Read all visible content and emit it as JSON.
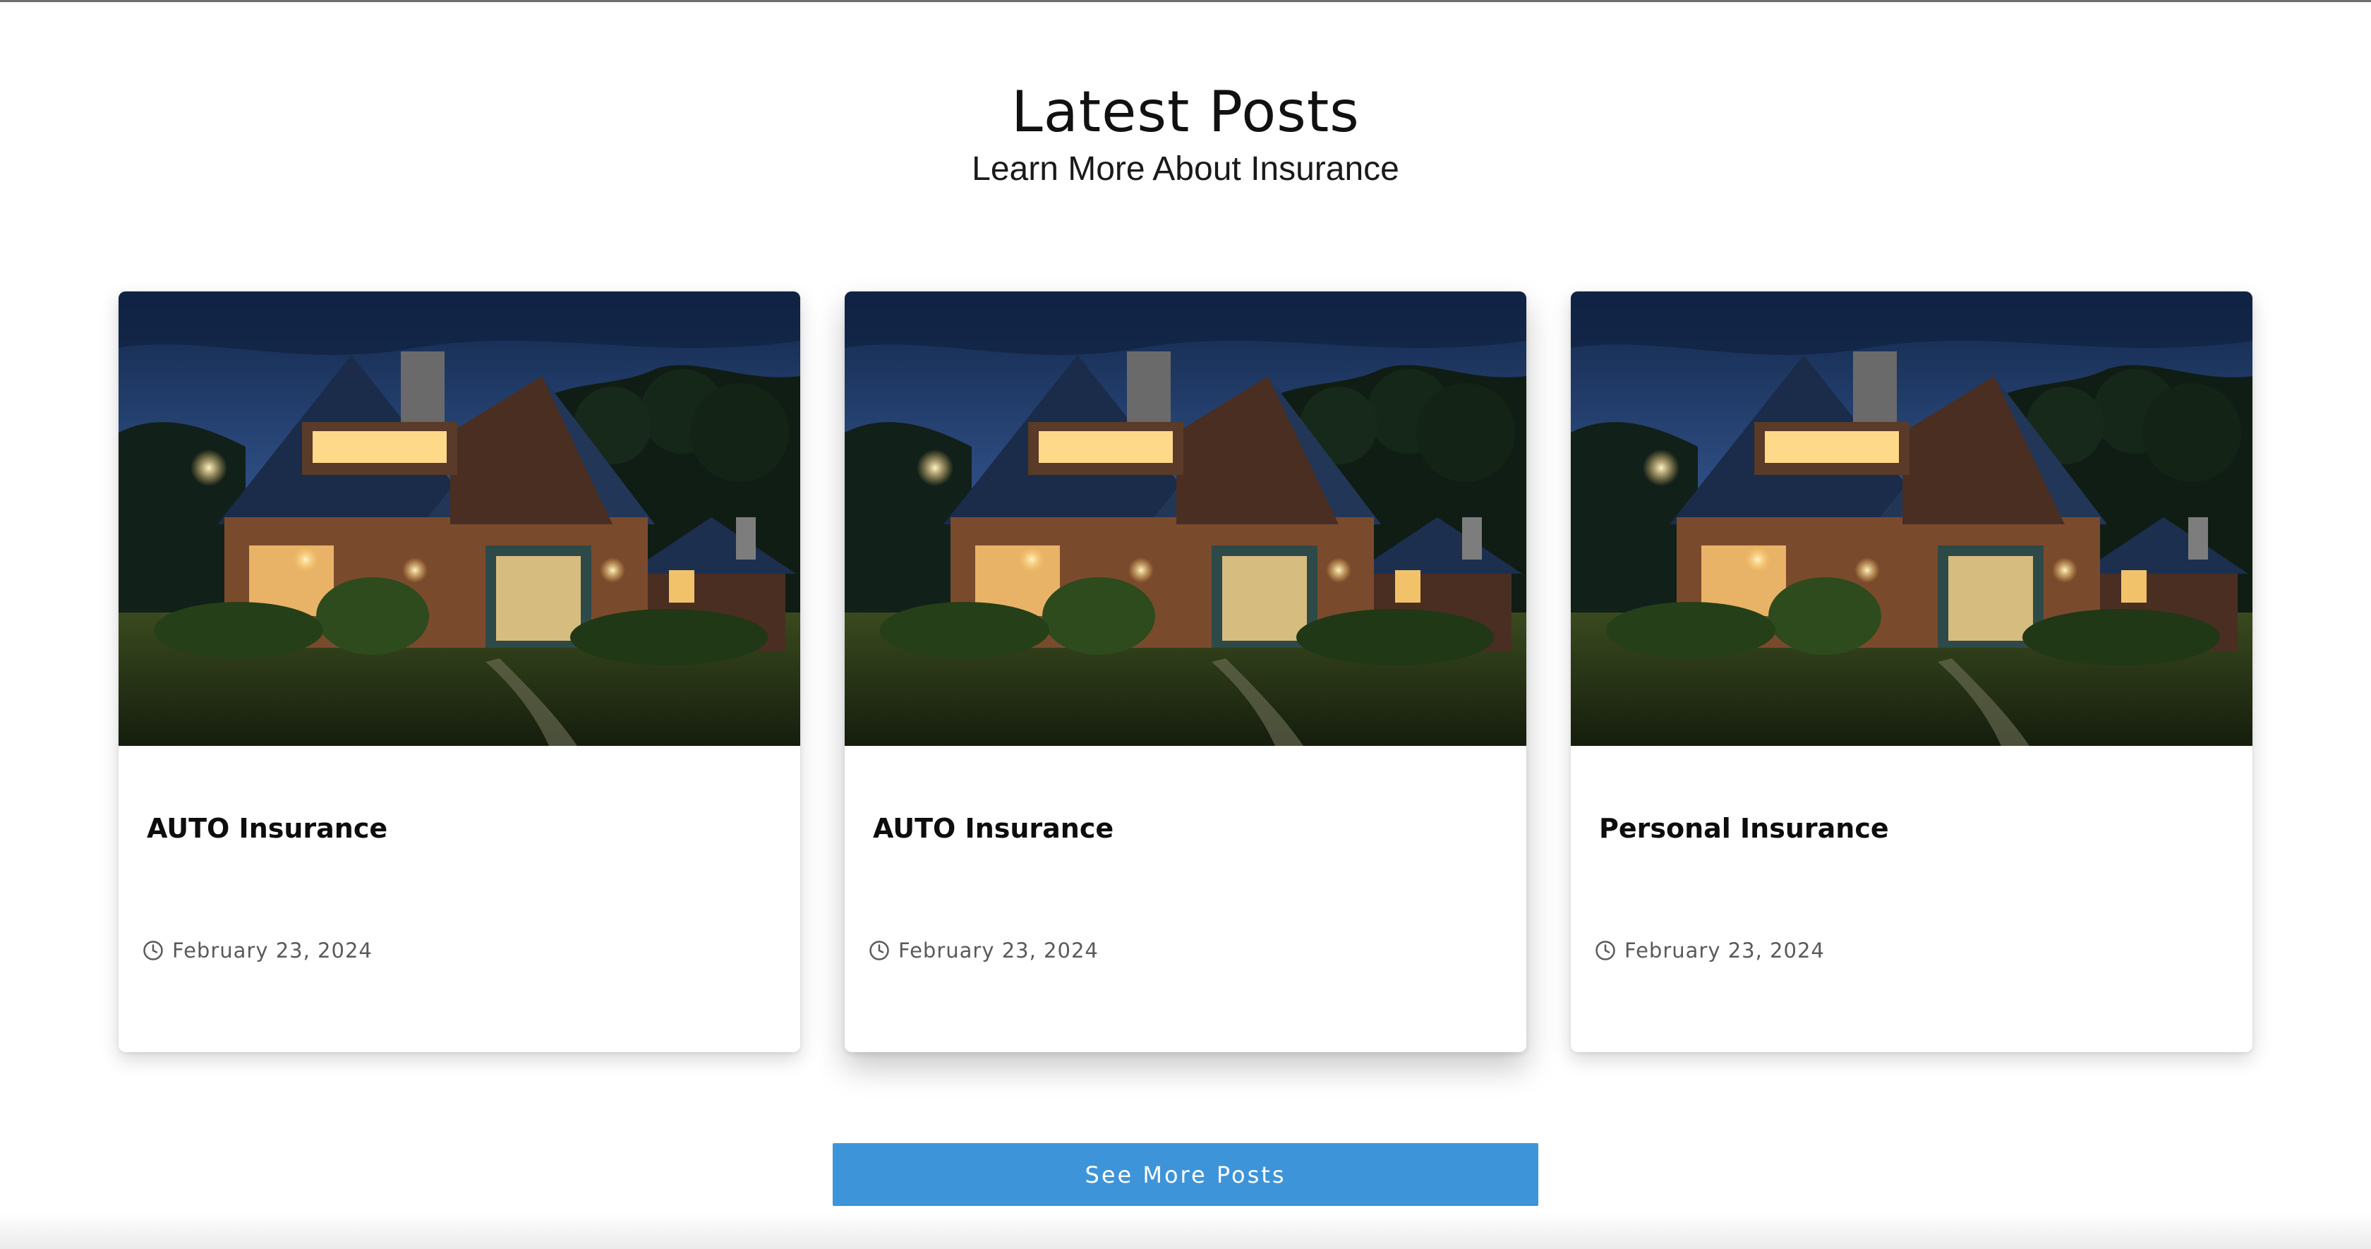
{
  "section": {
    "title": "Latest Posts",
    "subtitle": "Learn More About Insurance"
  },
  "posts": [
    {
      "title": "AUTO Insurance",
      "date": "February 23, 2024",
      "image_icon": "house-night-photo"
    },
    {
      "title": "AUTO Insurance",
      "date": "February 23, 2024",
      "image_icon": "house-night-photo"
    },
    {
      "title": "Personal Insurance",
      "date": "February 23, 2024",
      "image_icon": "house-night-photo"
    }
  ],
  "actions": {
    "see_more_label": "See More Posts"
  },
  "colors": {
    "button": "#3e94d8",
    "title_text": "#111111",
    "date_text": "#5a5a5a"
  }
}
